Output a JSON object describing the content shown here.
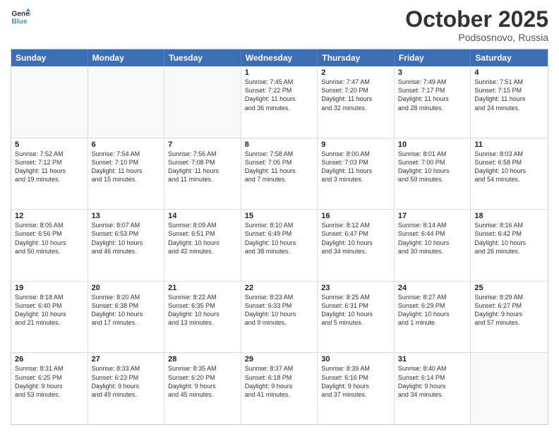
{
  "header": {
    "logo_line1": "General",
    "logo_line2": "Blue",
    "month": "October 2025",
    "location": "Podsosnovo, Russia"
  },
  "days_of_week": [
    "Sunday",
    "Monday",
    "Tuesday",
    "Wednesday",
    "Thursday",
    "Friday",
    "Saturday"
  ],
  "weeks": [
    [
      {
        "day": "",
        "text": "",
        "empty": true
      },
      {
        "day": "",
        "text": "",
        "empty": true
      },
      {
        "day": "",
        "text": "",
        "empty": true
      },
      {
        "day": "1",
        "text": "Sunrise: 7:45 AM\nSunset: 7:22 PM\nDaylight: 11 hours\nand 36 minutes."
      },
      {
        "day": "2",
        "text": "Sunrise: 7:47 AM\nSunset: 7:20 PM\nDaylight: 11 hours\nand 32 minutes."
      },
      {
        "day": "3",
        "text": "Sunrise: 7:49 AM\nSunset: 7:17 PM\nDaylight: 11 hours\nand 28 minutes."
      },
      {
        "day": "4",
        "text": "Sunrise: 7:51 AM\nSunset: 7:15 PM\nDaylight: 11 hours\nand 24 minutes."
      }
    ],
    [
      {
        "day": "5",
        "text": "Sunrise: 7:52 AM\nSunset: 7:12 PM\nDaylight: 11 hours\nand 19 minutes."
      },
      {
        "day": "6",
        "text": "Sunrise: 7:54 AM\nSunset: 7:10 PM\nDaylight: 11 hours\nand 15 minutes."
      },
      {
        "day": "7",
        "text": "Sunrise: 7:56 AM\nSunset: 7:08 PM\nDaylight: 11 hours\nand 11 minutes."
      },
      {
        "day": "8",
        "text": "Sunrise: 7:58 AM\nSunset: 7:05 PM\nDaylight: 11 hours\nand 7 minutes."
      },
      {
        "day": "9",
        "text": "Sunrise: 8:00 AM\nSunset: 7:03 PM\nDaylight: 11 hours\nand 3 minutes."
      },
      {
        "day": "10",
        "text": "Sunrise: 8:01 AM\nSunset: 7:00 PM\nDaylight: 10 hours\nand 59 minutes."
      },
      {
        "day": "11",
        "text": "Sunrise: 8:03 AM\nSunset: 6:58 PM\nDaylight: 10 hours\nand 54 minutes."
      }
    ],
    [
      {
        "day": "12",
        "text": "Sunrise: 8:05 AM\nSunset: 6:56 PM\nDaylight: 10 hours\nand 50 minutes."
      },
      {
        "day": "13",
        "text": "Sunrise: 8:07 AM\nSunset: 6:53 PM\nDaylight: 10 hours\nand 46 minutes."
      },
      {
        "day": "14",
        "text": "Sunrise: 8:09 AM\nSunset: 6:51 PM\nDaylight: 10 hours\nand 42 minutes."
      },
      {
        "day": "15",
        "text": "Sunrise: 8:10 AM\nSunset: 6:49 PM\nDaylight: 10 hours\nand 38 minutes."
      },
      {
        "day": "16",
        "text": "Sunrise: 8:12 AM\nSunset: 6:47 PM\nDaylight: 10 hours\nand 34 minutes."
      },
      {
        "day": "17",
        "text": "Sunrise: 8:14 AM\nSunset: 6:44 PM\nDaylight: 10 hours\nand 30 minutes."
      },
      {
        "day": "18",
        "text": "Sunrise: 8:16 AM\nSunset: 6:42 PM\nDaylight: 10 hours\nand 26 minutes."
      }
    ],
    [
      {
        "day": "19",
        "text": "Sunrise: 8:18 AM\nSunset: 6:40 PM\nDaylight: 10 hours\nand 21 minutes."
      },
      {
        "day": "20",
        "text": "Sunrise: 8:20 AM\nSunset: 6:38 PM\nDaylight: 10 hours\nand 17 minutes."
      },
      {
        "day": "21",
        "text": "Sunrise: 8:22 AM\nSunset: 6:35 PM\nDaylight: 10 hours\nand 13 minutes."
      },
      {
        "day": "22",
        "text": "Sunrise: 8:23 AM\nSunset: 6:33 PM\nDaylight: 10 hours\nand 9 minutes."
      },
      {
        "day": "23",
        "text": "Sunrise: 8:25 AM\nSunset: 6:31 PM\nDaylight: 10 hours\nand 5 minutes."
      },
      {
        "day": "24",
        "text": "Sunrise: 8:27 AM\nSunset: 6:29 PM\nDaylight: 10 hours\nand 1 minute."
      },
      {
        "day": "25",
        "text": "Sunrise: 8:29 AM\nSunset: 6:27 PM\nDaylight: 9 hours\nand 57 minutes."
      }
    ],
    [
      {
        "day": "26",
        "text": "Sunrise: 8:31 AM\nSunset: 6:25 PM\nDaylight: 9 hours\nand 53 minutes."
      },
      {
        "day": "27",
        "text": "Sunrise: 8:33 AM\nSunset: 6:23 PM\nDaylight: 9 hours\nand 49 minutes."
      },
      {
        "day": "28",
        "text": "Sunrise: 8:35 AM\nSunset: 6:20 PM\nDaylight: 9 hours\nand 45 minutes."
      },
      {
        "day": "29",
        "text": "Sunrise: 8:37 AM\nSunset: 6:18 PM\nDaylight: 9 hours\nand 41 minutes."
      },
      {
        "day": "30",
        "text": "Sunrise: 8:39 AM\nSunset: 6:16 PM\nDaylight: 9 hours\nand 37 minutes."
      },
      {
        "day": "31",
        "text": "Sunrise: 8:40 AM\nSunset: 6:14 PM\nDaylight: 9 hours\nand 34 minutes."
      },
      {
        "day": "",
        "text": "",
        "empty": true
      }
    ]
  ]
}
